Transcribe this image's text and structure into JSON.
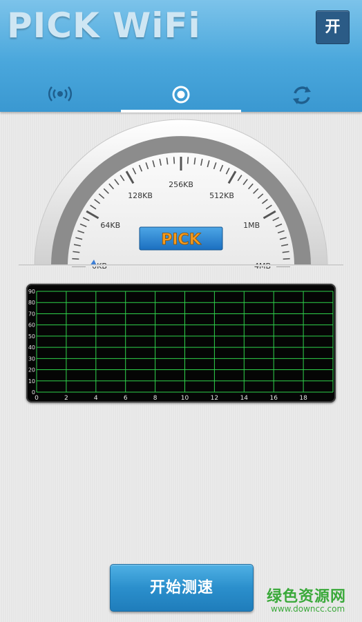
{
  "header": {
    "title": "PICK WiFi",
    "toggle_label": "开",
    "tabs": [
      {
        "icon": "signal-icon",
        "selected": false
      },
      {
        "icon": "speed-target-icon",
        "selected": true
      },
      {
        "icon": "refresh-icon",
        "selected": false
      }
    ]
  },
  "gauge": {
    "scale_labels": [
      "0KB",
      "64KB",
      "128KB",
      "256KB",
      "512KB",
      "1MB",
      "4MB"
    ],
    "center_label": "PICK",
    "needle_value_label": "0KB"
  },
  "graph": {
    "x_ticks": [
      "0",
      "2",
      "4",
      "6",
      "8",
      "10",
      "12",
      "14",
      "16",
      "18"
    ],
    "y_ticks": [
      "0",
      "10",
      "20",
      "30",
      "40",
      "50",
      "60",
      "70",
      "80",
      "90"
    ],
    "grid_color": "#2fd34b",
    "background": "#050505"
  },
  "actions": {
    "start_label": "开始测速"
  },
  "watermark": {
    "text": "绿色资源网",
    "url": "www.downcc.com"
  },
  "colors": {
    "header_blue": "#4aa7dc",
    "toggle_bg": "#2b5b86",
    "button_blue": "#2b8fcc",
    "pick_orange": "#f39a1f"
  }
}
